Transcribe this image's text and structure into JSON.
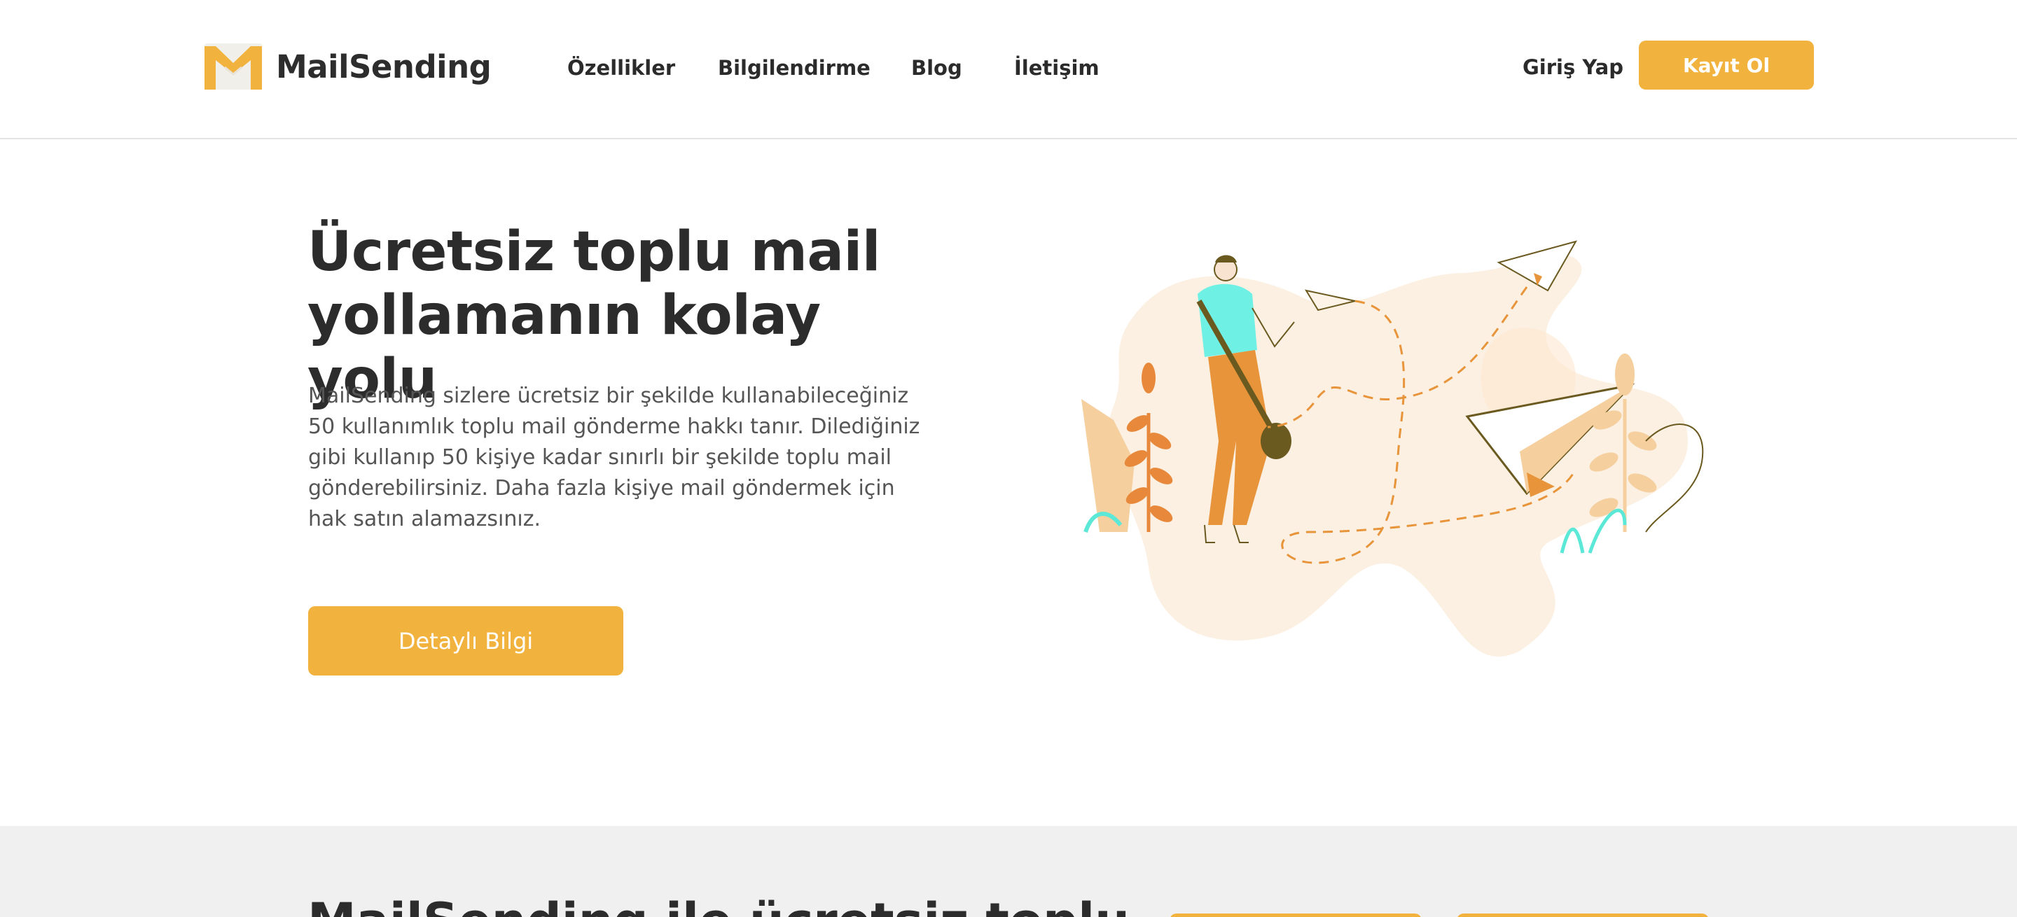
{
  "brand": {
    "name": "MailSending",
    "accent": "#f2b23e"
  },
  "nav": {
    "links": [
      "Özellikler",
      "Bilgilendirme",
      "Blog",
      "İletişim"
    ],
    "login_label": "Giriş Yap",
    "signup_label": "Kayıt Ol"
  },
  "hero": {
    "title_line1": "Ücretsiz toplu mail",
    "title_line2": "yollamanın kolay yolu",
    "description": "MailSending sizlere ücretsiz bir şekilde kullanabileceğiniz 50 kullanımlık toplu mail gönderme hakkı tanır. Dilediğiniz gibi kullanıp 50 kişiye kadar sınırlı bir şekilde toplu mail gönderebilirsiniz. Daha fazla kişiye mail göndermek için hak satın alamazsınız.",
    "cta_label": "Detaylı Bilgi"
  },
  "next_section": {
    "title": "MailSending ile ücretsiz toplu"
  }
}
